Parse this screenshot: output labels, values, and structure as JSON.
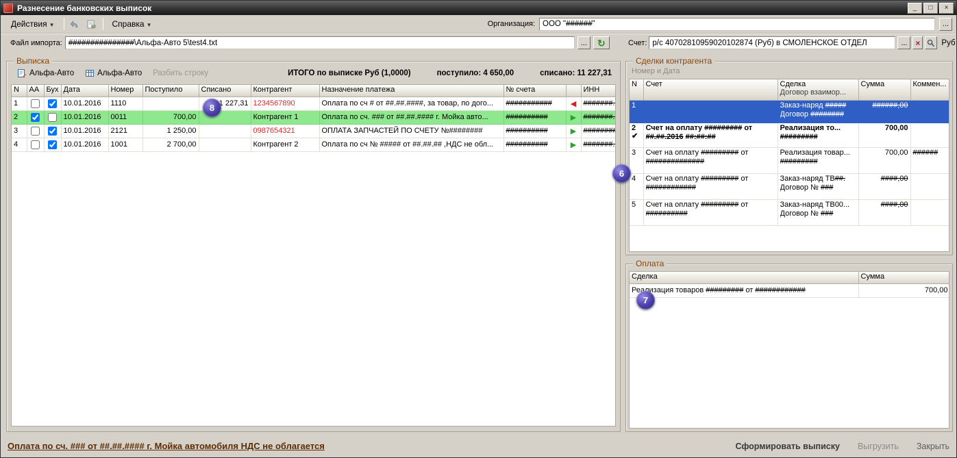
{
  "window": {
    "title": "Разнесение банковских выписок",
    "minimize": "_",
    "maximize": "□",
    "close": "×"
  },
  "menubar": {
    "actions": "Действия",
    "help": "Справка",
    "org_label": "Организация:",
    "org_value": "ООО \"######\"",
    "org_ellipsis": "..."
  },
  "import_row": {
    "label": "Файл импорта:",
    "value": "###############\\Альфа-Авто 5\\test4.txt",
    "ellipsis": "...",
    "refresh": "↻"
  },
  "account_row": {
    "label": "Счет:",
    "value": "р/с 40702810959020102874 (Руб) в СМОЛЕНСКОЕ ОТДЕЛ",
    "ellipsis": "...",
    "clear": "×",
    "currency": "Руб"
  },
  "statement": {
    "group_title": "Выписка",
    "toolbar": {
      "alfa1": "Альфа-Авто",
      "alfa2": "Альфа-Авто",
      "split": "Разбить строку"
    },
    "totals": {
      "total": "ИТОГО по выписке Руб (1,0000)",
      "received": "поступило: 4 650,00",
      "written_off": "списано: 11 227,31"
    },
    "columns": {
      "n": "N",
      "aa": "АА",
      "buh": "Бух",
      "date": "Дата",
      "number": "Номер",
      "received": "Поступило",
      "written": "Списано",
      "contractor": "Контрагент",
      "purpose": "Назначение платежа",
      "account": "№ счета",
      "arrow": "",
      "inn": "ИНН"
    },
    "rows": [
      {
        "n": "1",
        "aa": false,
        "buh": true,
        "date": "10.01.2016",
        "number": "1110",
        "received": "",
        "written": "11 227,31",
        "contractor": "1234567890",
        "contractor_class": "red-text",
        "purpose": "Оплата по сч # от ##.##.####, за товар, по дого...",
        "account": "###########",
        "arrow": "◀",
        "arrow_class": "arrow-red",
        "inn": "#######.."
      },
      {
        "n": "2",
        "aa": true,
        "buh": false,
        "date": "10.01.2016",
        "number": "0011",
        "received": "700,00",
        "written": "",
        "contractor": "Контрагент 1",
        "contractor_class": "",
        "purpose": "Оплата по сч. ### от ##.##.#### г. Мойка авто...",
        "account": "##########",
        "arrow": "▶",
        "arrow_class": "arrow-green",
        "inn": "#######.."
      },
      {
        "n": "3",
        "aa": false,
        "buh": true,
        "date": "10.01.2016",
        "number": "2121",
        "received": "1 250,00",
        "written": "",
        "contractor": "0987654321",
        "contractor_class": "red-text",
        "purpose": "ОПЛАТА ЗАПЧАСТЕЙ ПО СЧЕТУ №########",
        "account": "##########",
        "arrow": "▶",
        "arrow_class": "arrow-green",
        "inn": "########"
      },
      {
        "n": "4",
        "aa": false,
        "buh": true,
        "date": "10.01.2016",
        "number": "1001",
        "received": "2 700,00",
        "written": "",
        "contractor": "Контрагент 2",
        "contractor_class": "",
        "purpose": "Оплата по сч № ##### от ##.##.## ,НДС не обл...",
        "account": "##########",
        "arrow": "▶",
        "arrow_class": "arrow-green",
        "inn": "#######.."
      }
    ]
  },
  "deals": {
    "group_title": "Сделки контрагента",
    "subtitle": "Номер и Дата",
    "columns": {
      "n": "N",
      "account": "Счет",
      "deal": "Сделка",
      "deal_sub": "Договор взаимор...",
      "sum": "Сумма",
      "comment": "Коммен..."
    },
    "rows": [
      {
        "n": "1",
        "check": "",
        "acc1": "",
        "acc2": "",
        "deal1": "Заказ-наряд #####",
        "deal2": "Договор ########",
        "sum": "######,00",
        "comment": ""
      },
      {
        "n": "2",
        "check": "✔",
        "acc1": "Счет на оплату ######### от",
        "acc2": "##.##.2016 ##:##:##",
        "deal1": "Реализация то...",
        "deal2": "#########",
        "sum": "700,00",
        "comment": ""
      },
      {
        "n": "3",
        "check": "",
        "acc1": "Счет на оплату ######### от",
        "acc2": "##############",
        "deal1": "Реализация товар...",
        "deal2": "#########",
        "sum": "700,00",
        "comment": "######"
      },
      {
        "n": "4",
        "check": "",
        "acc1": "Счет на оплату ######### от",
        "acc2": "############",
        "deal1": "Заказ-наряд ТВ##.",
        "deal2": "Договор № ###",
        "sum": "####,00",
        "comment": ""
      },
      {
        "n": "5",
        "check": "",
        "acc1": "Счет на оплату ######### от",
        "acc2": "##########",
        "deal1": "Заказ-наряд ТВ00...",
        "deal2": "Договор № ###",
        "sum": "####,00",
        "comment": ""
      }
    ]
  },
  "payment": {
    "group_title": "Оплата",
    "columns": {
      "deal": "Сделка",
      "sum": "Сумма"
    },
    "rows": [
      {
        "deal": "Реализация товаров ######### от ############",
        "sum": "700,00"
      }
    ]
  },
  "footer": {
    "status": "Оплата по сч. ### от ##.##.#### г. Мойка автомобиля НДС не облагается",
    "generate": "Сформировать выписку",
    "export": "Выгрузить",
    "close": "Закрыть"
  },
  "badges": {
    "b8": "8",
    "b6": "6",
    "b7": "7"
  },
  "colors": {
    "selected_row_green": "#8ee98e",
    "selected_row_blue": "#2f5fc4",
    "error_red": "#d92b2b",
    "arrow_green": "#2ea22e",
    "arrow_red": "#cc2222",
    "group_caption": "#8c4406",
    "status_text": "#5e2c04",
    "badge_purple": "#4d43ad"
  }
}
